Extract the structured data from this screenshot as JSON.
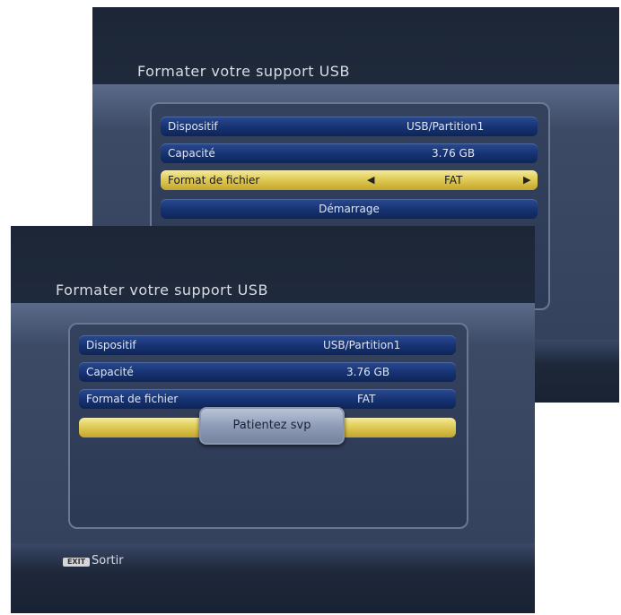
{
  "top_screen": {
    "title": "Formater votre support USB",
    "rows": [
      {
        "label": "Dispositif",
        "value": "USB/Partition1"
      },
      {
        "label": "Capacité",
        "value": "3.76 GB"
      },
      {
        "label": "Format de fichier",
        "value": "FAT"
      }
    ],
    "start_button": "Démarrage",
    "arrow_left": "◀",
    "arrow_right": "▶"
  },
  "bottom_screen": {
    "title": "Formater votre support USB",
    "rows": [
      {
        "label": "Dispositif",
        "value": "USB/Partition1"
      },
      {
        "label": "Capacité",
        "value": "3.76 GB"
      },
      {
        "label": "Format de fichier",
        "value": "FAT"
      }
    ],
    "popup": "Patientez svp",
    "footer": {
      "key": "EXIT",
      "label": "Sortir"
    }
  }
}
